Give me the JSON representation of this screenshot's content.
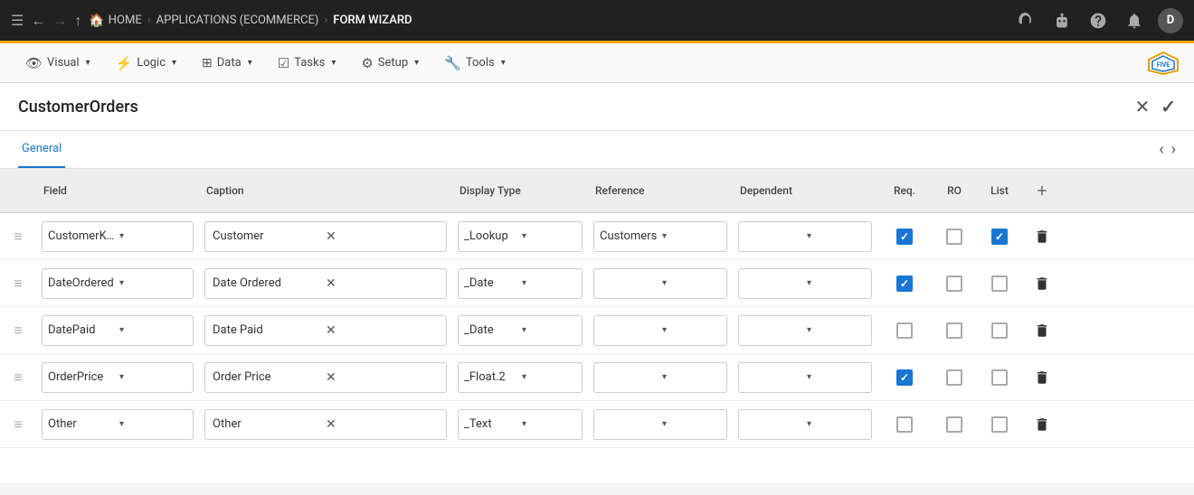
{
  "topbar": {
    "menu_icon": "☰",
    "back_icon": "←",
    "forward_icon": "→",
    "up_icon": "↑",
    "home_label": "HOME",
    "breadcrumb": [
      {
        "label": "APPLICATIONS (ECOMMERCE)",
        "active": false
      },
      {
        "label": "FORM WIZARD",
        "active": true
      }
    ],
    "icons": [
      "headset",
      "robot",
      "help",
      "bell"
    ],
    "avatar_letter": "D"
  },
  "secnav": {
    "items": [
      {
        "icon": "👁",
        "label": "Visual",
        "has_arrow": true
      },
      {
        "icon": "⚡",
        "label": "Logic",
        "has_arrow": true
      },
      {
        "icon": "⊞",
        "label": "Data",
        "has_arrow": true
      },
      {
        "icon": "☑",
        "label": "Tasks",
        "has_arrow": true
      },
      {
        "icon": "⚙",
        "label": "Setup",
        "has_arrow": true
      },
      {
        "icon": "🔧",
        "label": "Tools",
        "has_arrow": true
      }
    ],
    "logo_text": "FIVE"
  },
  "page": {
    "title": "CustomerOrders",
    "close_icon": "✕",
    "check_icon": "✓"
  },
  "tabs": {
    "items": [
      {
        "label": "General"
      }
    ],
    "prev_icon": "‹",
    "next_icon": "›"
  },
  "table": {
    "columns": [
      {
        "label": "",
        "key": "drag"
      },
      {
        "label": "Field",
        "key": "field"
      },
      {
        "label": "Caption",
        "key": "caption"
      },
      {
        "label": "Display Type",
        "key": "display_type"
      },
      {
        "label": "Reference",
        "key": "reference"
      },
      {
        "label": "Dependent",
        "key": "dependent"
      },
      {
        "label": "Req.",
        "key": "req"
      },
      {
        "label": "RO",
        "key": "ro"
      },
      {
        "label": "List",
        "key": "list"
      },
      {
        "label": "+",
        "key": "add"
      }
    ],
    "rows": [
      {
        "field": "CustomerKey",
        "caption": "Customer",
        "display_type": "_Lookup",
        "reference": "Customers",
        "dependent": "",
        "req": true,
        "ro": false,
        "list": true
      },
      {
        "field": "DateOrdered",
        "caption": "Date Ordered",
        "display_type": "_Date",
        "reference": "",
        "dependent": "",
        "req": true,
        "ro": false,
        "list": false
      },
      {
        "field": "DatePaid",
        "caption": "Date Paid",
        "display_type": "_Date",
        "reference": "",
        "dependent": "",
        "req": false,
        "ro": false,
        "list": false
      },
      {
        "field": "OrderPrice",
        "caption": "Order Price",
        "display_type": "_Float.2",
        "reference": "",
        "dependent": "",
        "req": true,
        "ro": false,
        "list": false
      },
      {
        "field": "Other",
        "caption": "Other",
        "display_type": "_Text",
        "reference": "",
        "dependent": "",
        "req": false,
        "ro": false,
        "list": false
      }
    ]
  }
}
